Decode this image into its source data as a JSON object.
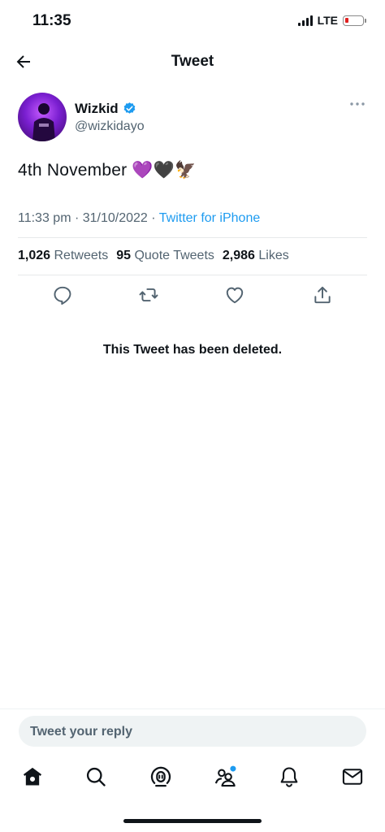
{
  "status_bar": {
    "time": "11:35",
    "network": "LTE",
    "battery_color": "#e02020"
  },
  "header": {
    "title": "Tweet",
    "back_icon": "arrow-left-icon"
  },
  "tweet": {
    "author_name": "Wizkid",
    "handle": "@wizkidayo",
    "verified_color": "#1d9bf0",
    "text": "4th November 💜🖤🦅",
    "timestamp": "11:33 pm · 31/10/2022 · ",
    "source": "Twitter for iPhone",
    "stats": {
      "retweets_count": "1,026",
      "retweets_label": "Retweets",
      "quotes_count": "95",
      "quotes_label": "Quote Tweets",
      "likes_count": "2,986",
      "likes_label": "Likes"
    },
    "actions": [
      "reply-icon",
      "retweet-icon",
      "like-icon",
      "share-icon"
    ]
  },
  "deleted_notice": "This Tweet has been deleted.",
  "reply": {
    "placeholder": "Tweet your reply"
  },
  "tabbar": {
    "tabs": [
      "home-icon",
      "search-icon",
      "spaces-icon",
      "communities-icon",
      "notifications-icon",
      "messages-icon"
    ],
    "accent": "#1d9bf0"
  }
}
